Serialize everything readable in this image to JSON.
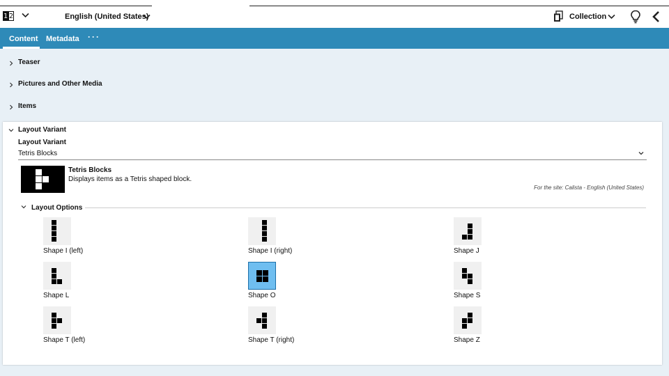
{
  "header": {
    "locale_icon_digits": [
      "1",
      "2"
    ],
    "language": "English (United States)",
    "collection_label": "Collection"
  },
  "tabs": [
    {
      "label": "Content",
      "active": true
    },
    {
      "label": "Metadata",
      "active": false
    },
    {
      "label": "···",
      "active": false
    }
  ],
  "sections": [
    {
      "label": "Teaser",
      "expanded": false
    },
    {
      "label": "Pictures and Other Media",
      "expanded": false
    },
    {
      "label": "Items",
      "expanded": false
    },
    {
      "label": "Layout Variant",
      "expanded": true
    }
  ],
  "layout_variant": {
    "field_label": "Layout Variant",
    "selected": "Tetris Blocks",
    "title": "Tetris Blocks",
    "description": "Displays items as a Tetris shaped block.",
    "site_note": "For the site: Calista - English (United States)",
    "options_label": "Layout Options"
  },
  "shapes": [
    {
      "label": "Shape I (left)",
      "selected": false
    },
    {
      "label": "Shape I (right)",
      "selected": false
    },
    {
      "label": "Shape J",
      "selected": false
    },
    {
      "label": "Shape L",
      "selected": false
    },
    {
      "label": "Shape O",
      "selected": true
    },
    {
      "label": "Shape S",
      "selected": false
    },
    {
      "label": "Shape T (left)",
      "selected": false
    },
    {
      "label": "Shape T (right)",
      "selected": false
    },
    {
      "label": "Shape Z",
      "selected": false
    }
  ],
  "colors": {
    "tab_bar": "#2e8ab8",
    "selected_tile": "#6fbef0",
    "background": "#e8f0f6"
  },
  "icons": [
    "locale-icon",
    "chevron-down-icon",
    "collection-icon",
    "lightbulb-icon",
    "chevron-left-icon",
    "chevron-right-icon"
  ]
}
